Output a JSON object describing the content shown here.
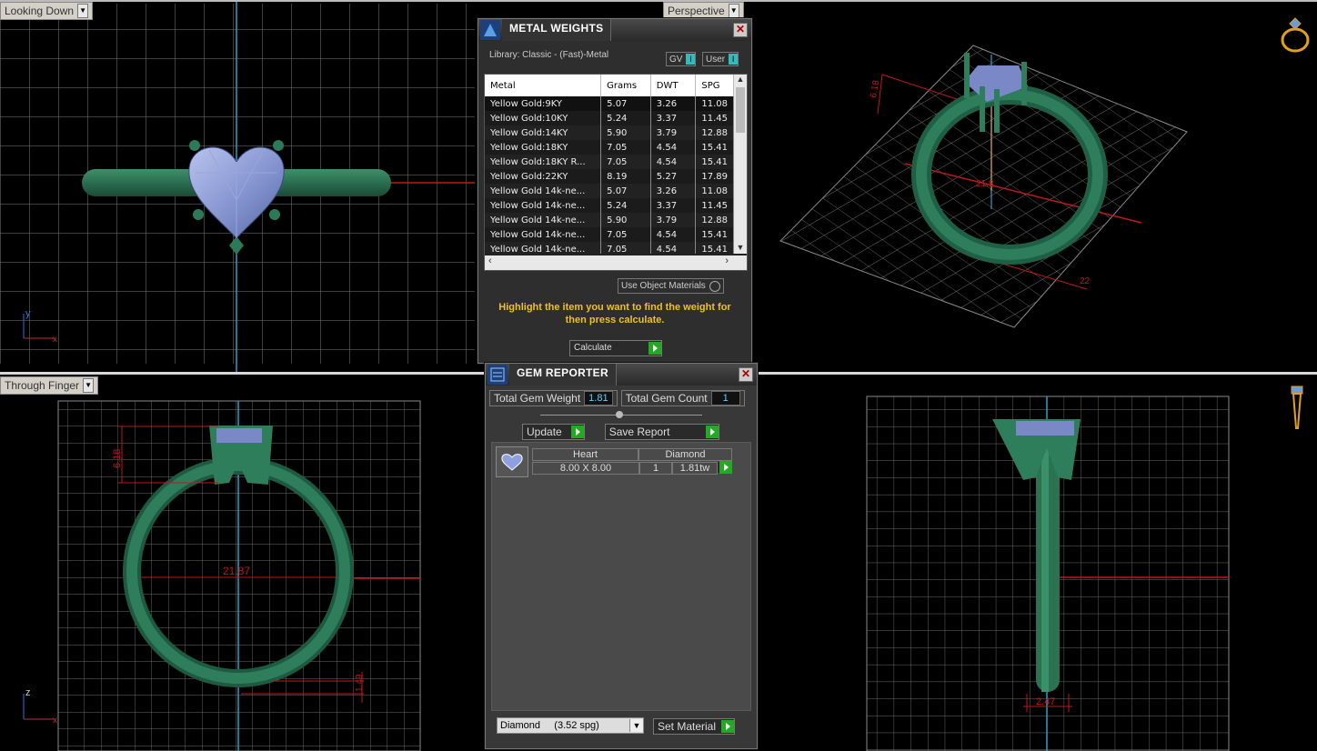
{
  "viewports": {
    "top_left": {
      "label": "Looking Down"
    },
    "top_right": {
      "label": "Perspective"
    },
    "bottom_left": {
      "label": "Through Finger"
    },
    "bottom_right": {
      "label": ""
    }
  },
  "dimensions": {
    "persp_height": "6.18",
    "persp_width": "22",
    "persp_mid": "21.8",
    "front_height": "6.18",
    "front_inner": "21.87",
    "front_shank": "1.49",
    "side_shank": "2.47"
  },
  "axes": {
    "y": "y",
    "x": "x",
    "z": "z"
  },
  "metal_weights": {
    "title": "METAL WEIGHTS",
    "library": "Library: Classic - (Fast)-Metal",
    "gv_label": "GV",
    "user_label": "User",
    "columns": [
      "Metal",
      "Grams",
      "DWT",
      "SPG"
    ],
    "rows": [
      [
        "Yellow Gold:9KY",
        "5.07",
        "3.26",
        "11.08"
      ],
      [
        "Yellow Gold:10KY",
        "5.24",
        "3.37",
        "11.45"
      ],
      [
        "Yellow Gold:14KY",
        "5.90",
        "3.79",
        "12.88"
      ],
      [
        "Yellow Gold:18KY",
        "7.05",
        "4.54",
        "15.41"
      ],
      [
        "Yellow Gold:18KY R...",
        "7.05",
        "4.54",
        "15.41"
      ],
      [
        "Yellow Gold:22KY",
        "8.19",
        "5.27",
        "17.89"
      ],
      [
        "Yellow Gold 14k-ne...",
        "5.07",
        "3.26",
        "11.08"
      ],
      [
        "Yellow Gold 14k-ne...",
        "5.24",
        "3.37",
        "11.45"
      ],
      [
        "Yellow Gold 14k-ne...",
        "5.90",
        "3.79",
        "12.88"
      ],
      [
        "Yellow Gold 14k-ne...",
        "7.05",
        "4.54",
        "15.41"
      ],
      [
        "Yellow Gold 14k-ne...",
        "7.05",
        "4.54",
        "15.41"
      ]
    ],
    "use_object_materials": "Use Object Materials",
    "hint": "Highlight the item you want to find the weight for then press calculate.",
    "calculate": "Calculate"
  },
  "gem_reporter": {
    "title": "GEM REPORTER",
    "total_weight_label": "Total Gem Weight",
    "total_weight_value": "1.81",
    "total_count_label": "Total Gem Count",
    "total_count_value": "1",
    "update": "Update",
    "save_report": "Save Report",
    "gem": {
      "shape": "Heart",
      "type": "Diamond",
      "size": "8.00 X 8.00",
      "count": "1",
      "weight": "1.81tw"
    },
    "material_select": "Diamond     (3.52 spg)",
    "set_material": "Set Material"
  }
}
